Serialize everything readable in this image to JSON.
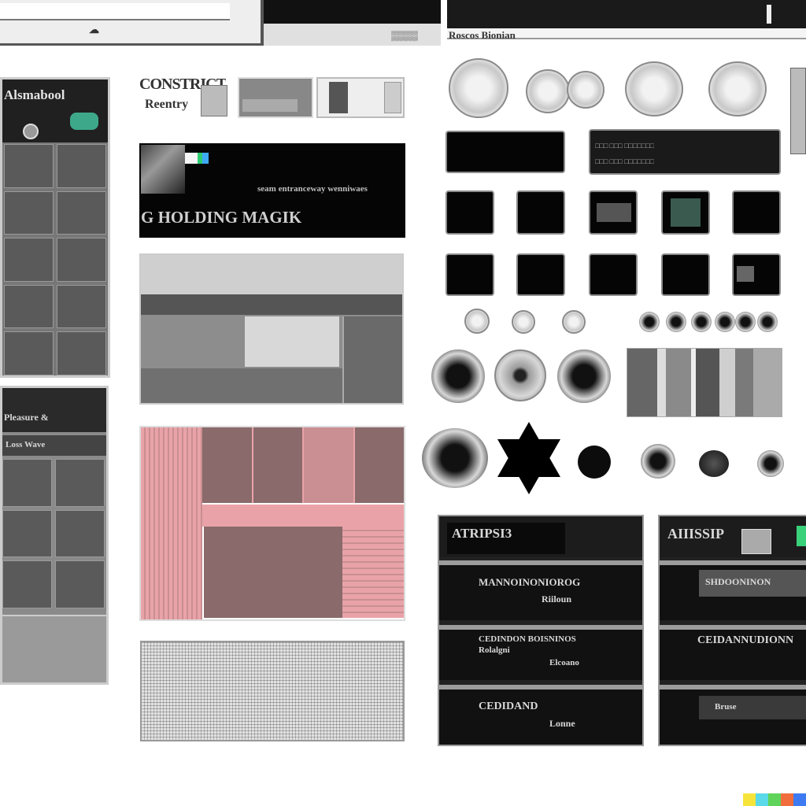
{
  "topbar": {
    "caption_left": "☁",
    "caption_mid": "▒▒▒▒",
    "caption_right": "Roscos Bionian"
  },
  "left_panel": {
    "header_text": "Alsmabool",
    "lower_header": "Pleasure &",
    "lower_sub": "Loss Wave"
  },
  "center": {
    "top_label": "CONSTRICT",
    "top_sub": "Reentry",
    "banner_small": "seam  entranceway  wenniwaes",
    "banner_large": "G HOLDING MAGIK",
    "pink_colors": [
      "#e9a3a8",
      "#c98f93",
      "#8a6a6b"
    ],
    "accent_colors": [
      "#2ecc71",
      "#3fa9f5",
      "#f5f5f5"
    ]
  },
  "right": {
    "wide_tile_row1": "□□□  □□□  □□□□□□□",
    "wide_tile_row2": "□□□  □□□  □□□□□□□",
    "star_icon": "star-of-david-icon"
  },
  "bottom_panels": {
    "left": [
      "ATRIPSI3",
      "MANNOINONIOROG",
      "Riiloun",
      "CEDINDON BOISNINOS",
      "Rolalgni",
      "Elcoano",
      "CEDIDAND",
      "Lonne"
    ],
    "right": [
      "AIIISSIP",
      "SHDOONINON",
      "CEIDANNUDIONN",
      "Bruse"
    ],
    "green_accent": "#39d17a"
  },
  "watermark_colors": [
    "#f7e43b",
    "#5ad9e8",
    "#5fd35a",
    "#f26d3d",
    "#3e7bf2"
  ]
}
